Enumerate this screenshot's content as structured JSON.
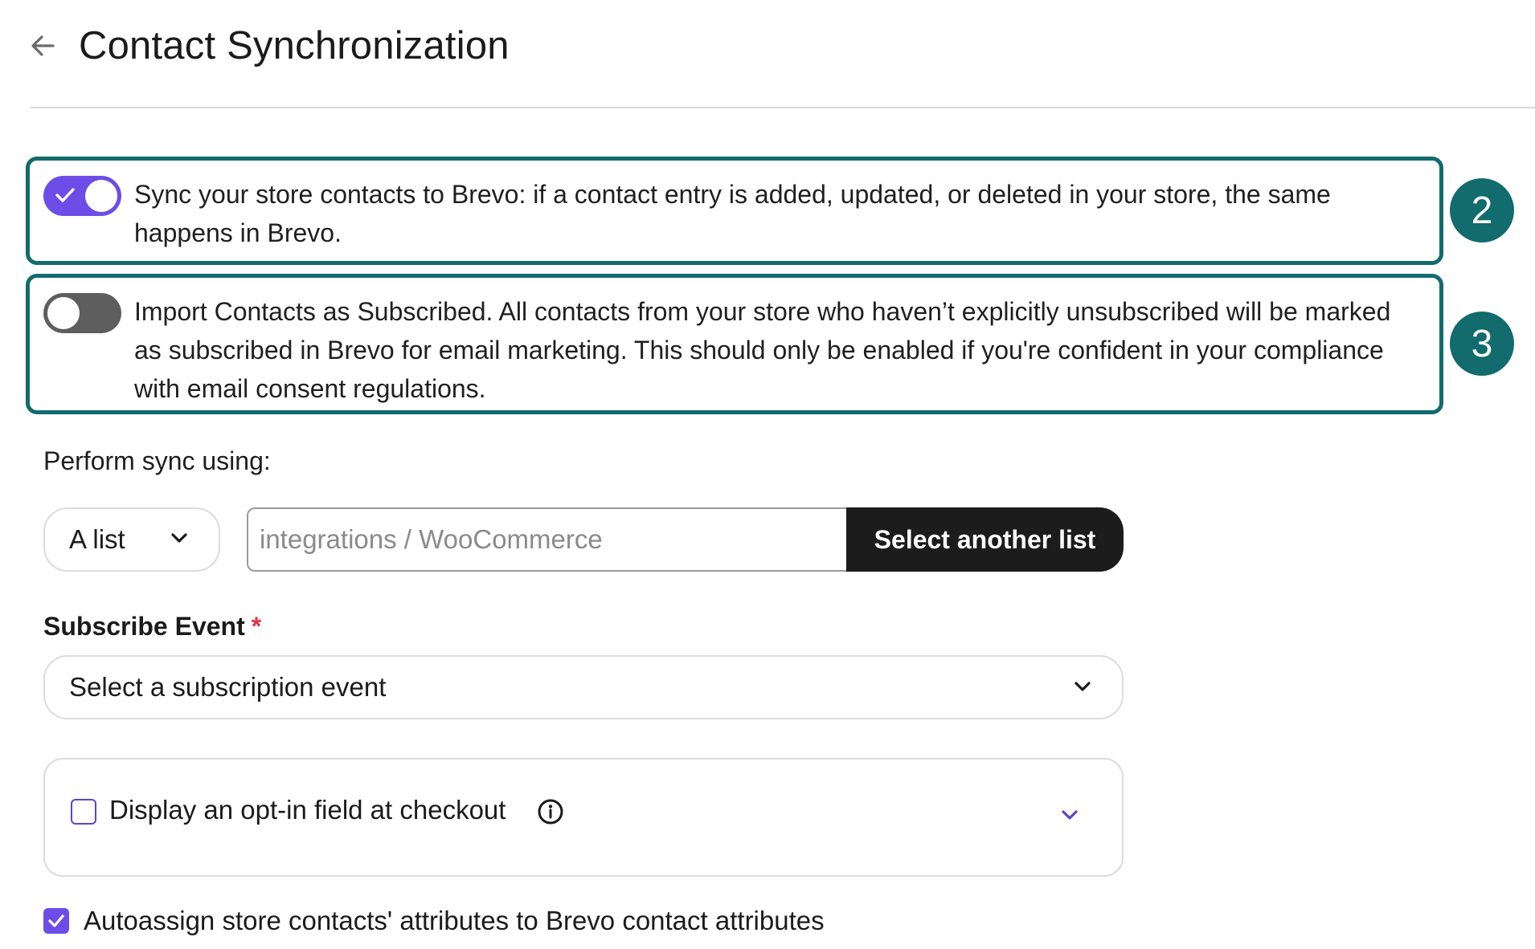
{
  "header": {
    "title": "Contact Synchronization",
    "back_icon": "arrow-left-icon"
  },
  "options": [
    {
      "enabled": true,
      "text": "Sync your store contacts to Brevo: if a contact entry is added, updated, or deleted in your store, the same happens in Brevo.",
      "badge": "2"
    },
    {
      "enabled": false,
      "text": "Import Contacts as Subscribed. All contacts from your store who haven’t explicitly unsubscribed will be marked as subscribed in Brevo for email marketing. This should only be enabled if you're confident in your compliance with email consent regulations.",
      "badge": "3"
    }
  ],
  "sync": {
    "label": "Perform sync using:",
    "type_value": "A list",
    "list_placeholder": "integrations / WooCommerce",
    "select_button": "Select another list"
  },
  "subscribe_event": {
    "label": "Subscribe Event",
    "required_mark": "*",
    "placeholder": "Select a subscription event"
  },
  "optin": {
    "checked": false,
    "label": "Display an opt-in field at checkout",
    "info_icon": "info-icon",
    "expand_icon": "chevron-down-icon"
  },
  "autoassign": {
    "checked": true,
    "label": "Autoassign store contacts' attributes to Brevo contact attributes"
  },
  "colors": {
    "accent": "#6c4de8",
    "highlight": "#126b6d",
    "button_dark": "#1c1c1c",
    "required": "#e0334a"
  }
}
